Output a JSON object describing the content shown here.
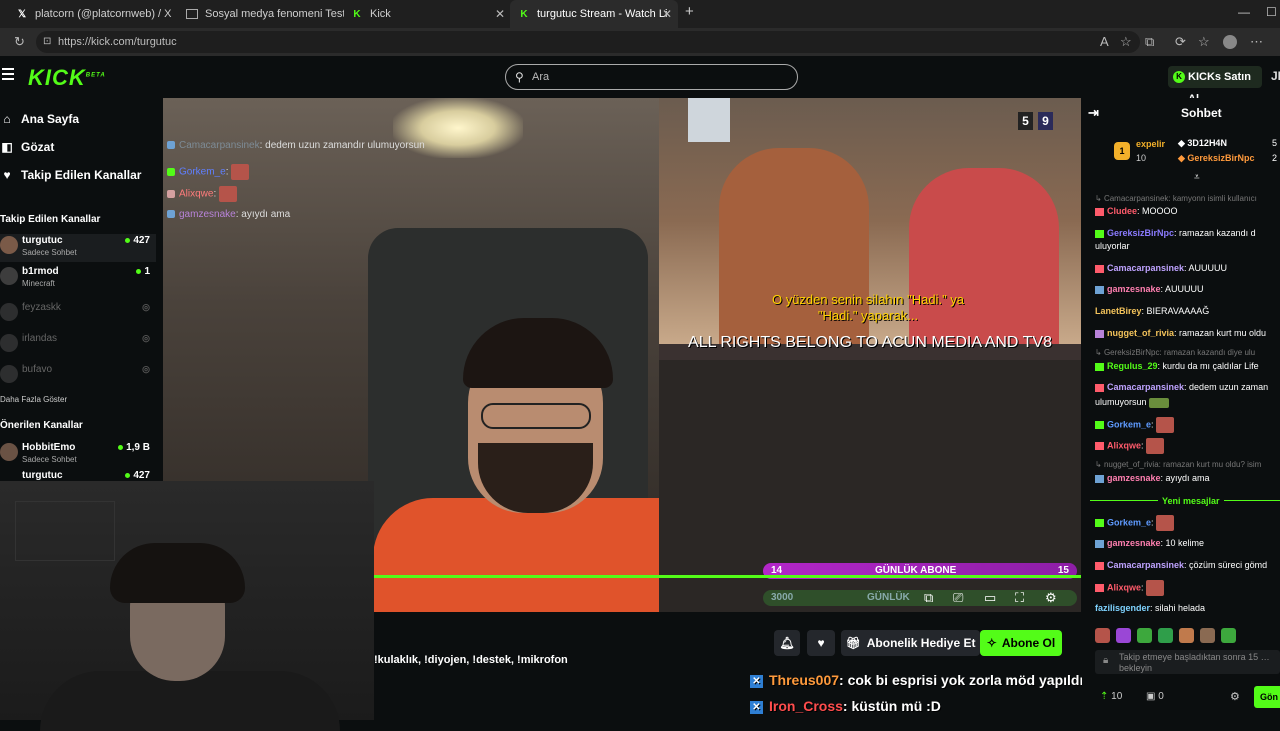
{
  "browser": {
    "tabs": [
      {
        "title": "platcorn (@platcornweb) / X",
        "icon": "X"
      },
      {
        "title": "Sosyal medya fenomeni Testo Tay…",
        "icon": "article"
      },
      {
        "title": "Kick",
        "icon": "K"
      },
      {
        "title": "turgutuc Stream - Watch Live on K…",
        "icon": "K"
      }
    ],
    "url": "https://kick.com/turgutuc"
  },
  "header": {
    "logo": "KICK",
    "logo_sup": "BETA",
    "search_placeholder": "Ara",
    "kicks_button": "KICKs Satın Al",
    "user_initials": "JL"
  },
  "sidebar": {
    "nav": [
      {
        "label": "Ana Sayfa",
        "icon": "home-icon"
      },
      {
        "label": "Gözat",
        "icon": "browse-icon"
      },
      {
        "label": "Takip Edilen Kanallar",
        "icon": "heart-icon"
      }
    ],
    "followed_title": "Takip Edilen Kanallar",
    "followed": [
      {
        "name": "turgutuc",
        "sub": "Sadece Sohbet",
        "viewers": "427",
        "live": true
      },
      {
        "name": "b1rmod",
        "sub": "Minecraft",
        "viewers": "1",
        "live": true
      },
      {
        "name": "feyzaskk",
        "sub": "",
        "viewers": "",
        "live": false
      },
      {
        "name": "irlandas",
        "sub": "",
        "viewers": "",
        "live": false
      },
      {
        "name": "bufavo",
        "sub": "",
        "viewers": "",
        "live": false
      }
    ],
    "show_more": "Daha Fazla Göster",
    "recommended_title": "Önerilen Kanallar",
    "recommended": [
      {
        "name": "HobbitEmo",
        "sub": "Sadece Sohbet",
        "viewers": "1,9 B"
      },
      {
        "name": "turgutuc",
        "sub": "",
        "viewers": "427"
      }
    ]
  },
  "stream": {
    "overlay_chat": [
      {
        "user": "Camacarpansinek",
        "text": ": dedem uzun zamandır ulumuyorsun"
      },
      {
        "user": "Gorkem_e",
        "text": ":"
      },
      {
        "user": "Alixqwe",
        "text": ":"
      },
      {
        "user": "gamzesnake",
        "text": ": ayıydı ama"
      }
    ],
    "scoreboard": [
      "5",
      "9"
    ],
    "subtitle_line1": "O yüzden senin silahın \"Hadi.\" ya",
    "subtitle_line2": "\"Hadi.\" yaparak...",
    "rights_text": "ALL RIGHTS BELONG TO ACUN MEDIA AND TV8",
    "sub_goal": {
      "left": "14",
      "label": "GÜNLÜK ABONE",
      "right": "15"
    },
    "sub_goal2": {
      "left": "3000",
      "label": "GÜNLÜK"
    },
    "commands": "!kulaklık, !diyojen, !destek, !mikrofon",
    "ticker": [
      {
        "user": "Threus007",
        "text": ": cok bi esprisi yok zorla möd yapıldım cocuk isci gibi calıstırılıyorum"
      },
      {
        "user": "Iron_Cross",
        "text": ": küstün mü :D"
      }
    ]
  },
  "actions": {
    "gift_sub": "Abonelik Hediye Et",
    "subscribe": "Abone Ol"
  },
  "chat": {
    "title": "Sohbet",
    "pinned_gifter": {
      "name": "expelir",
      "count": "10"
    },
    "pinned_list": [
      {
        "name": "3D12H4N",
        "count": "5"
      },
      {
        "name": "GereksizBirNpc",
        "count": "2"
      }
    ],
    "messages": [
      {
        "reply": true,
        "text": "Camacarpansinek: kamyonn isimli kullanıcı"
      },
      {
        "user": "Cludee",
        "color": "#ff5b6b",
        "text": ": MOOOO"
      },
      {
        "user": "GereksizBirNpc",
        "color": "#8b7bff",
        "text": ": ramazan kazandı d"
      },
      {
        "cont": true,
        "text": "uluyorlar"
      },
      {
        "user": "Camacarpansinek",
        "color": "#bfa3ff",
        "text": ": AUUUUU"
      },
      {
        "user": "gamzesnake",
        "color": "#ff7fb0",
        "text": ": AUUUUU"
      },
      {
        "user": "LanetBirey",
        "color": "#f3c35b",
        "text": ": BIERAVAAAAĞ"
      },
      {
        "user": "nugget_of_rivia",
        "color": "#f3c35b",
        "text": ": ramazan kurt mu oldu"
      },
      {
        "reply": true,
        "text": "GereksizBirNpc: ramazan kazandı diye ulu"
      },
      {
        "user": "Regulus_29",
        "color": "#53fc18",
        "text": ": kurdu da mı çaldılar Life"
      },
      {
        "user": "Camacarpansinek",
        "color": "#bfa3ff",
        "text": ": dedem uzun zaman"
      },
      {
        "cont": true,
        "text": "ulumuyorsun"
      },
      {
        "user": "Gorkem_e",
        "color": "#5f9bff",
        "text": ":"
      },
      {
        "user": "Alixqwe",
        "color": "#ff5b6b",
        "text": ":"
      },
      {
        "reply": true,
        "text": "nugget_of_rivia: ramazan kurt mu oldu? isim"
      },
      {
        "user": "gamzesnake",
        "color": "#ff7fb0",
        "text": ": ayıydı ama"
      }
    ],
    "new_messages": "Yeni mesajlar",
    "messages2": [
      {
        "user": "Gorkem_e",
        "color": "#5f9bff",
        "text": ":"
      },
      {
        "user": "gamzesnake",
        "color": "#ff7fb0",
        "text": ": 10 kelime"
      },
      {
        "user": "Camacarpansinek",
        "color": "#bfa3ff",
        "text": ": çözüm süreci gömd"
      },
      {
        "user": "Alixqwe",
        "color": "#ff5b6b",
        "text": ":"
      },
      {
        "user": "fazilisgender",
        "color": "#7fd3ff",
        "text": ": silahi helada"
      }
    ],
    "input_placeholder": "Takip etmeye başladıktan sonra 15 … bekleyin",
    "points": "10",
    "bottom_count": "0",
    "send_label": "Gön"
  }
}
